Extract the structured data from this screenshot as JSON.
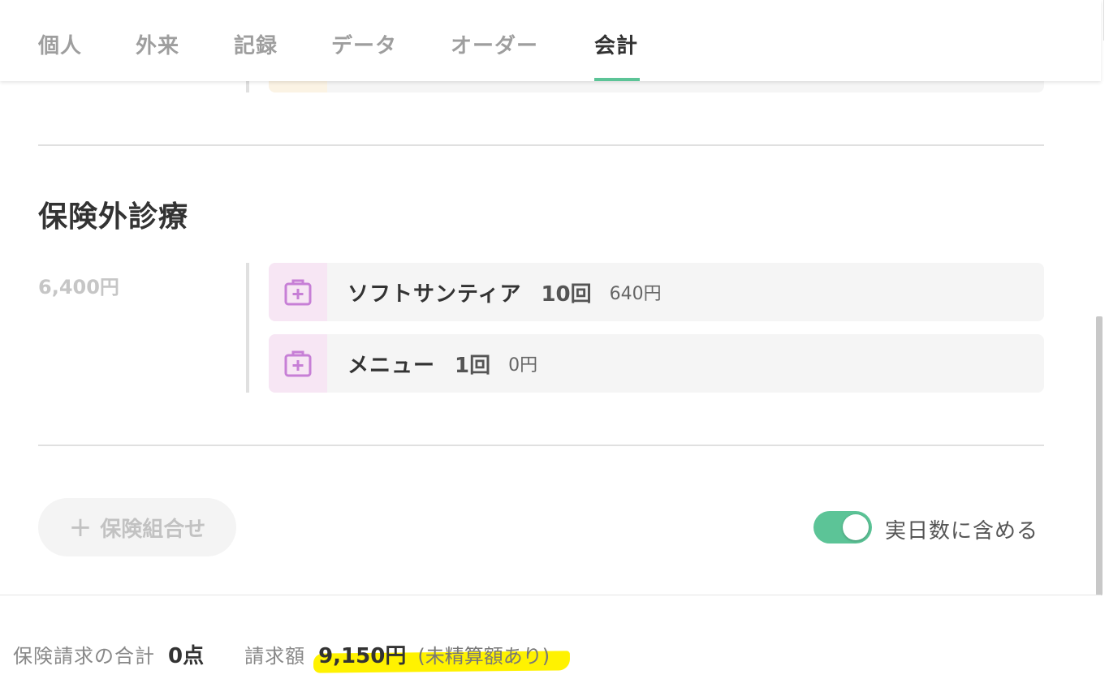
{
  "tabs": [
    {
      "label": "個人",
      "active": false
    },
    {
      "label": "外来",
      "active": false
    },
    {
      "label": "記録",
      "active": false
    },
    {
      "label": "データ",
      "active": false
    },
    {
      "label": "オーダー",
      "active": false
    },
    {
      "label": "会計",
      "active": true
    }
  ],
  "section": {
    "title": "保険外診療",
    "amount": "6,400円",
    "items": [
      {
        "icon": "medical-kit-icon",
        "name": "ソフトサンティア",
        "count": "10回",
        "price": "640円"
      },
      {
        "icon": "medical-kit-icon",
        "name": "メニュー",
        "count": "1回",
        "price": "0円"
      }
    ]
  },
  "actions": {
    "add_insurance_label": "保険組合せ",
    "toggle_label": "実日数に含める",
    "toggle_on": true
  },
  "footer": {
    "insurance_total_label": "保険請求の合計",
    "insurance_total_value": "0点",
    "billing_label": "請求額",
    "billing_value": "9,150円",
    "billing_note": "(未精算額あり)"
  },
  "colors": {
    "accent": "#5cc497",
    "icon": "#c77fd6",
    "icon_bg": "#f7e6f4",
    "highlight": "#fff200"
  }
}
